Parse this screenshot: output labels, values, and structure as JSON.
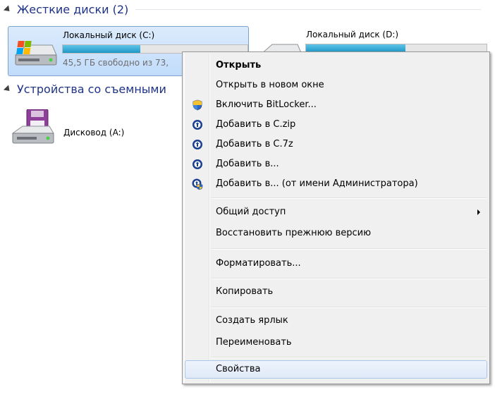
{
  "groups": {
    "hard_disks": {
      "title": "Жесткие диски (2)"
    },
    "removable": {
      "title": "Устройства со съемными"
    }
  },
  "drives": {
    "c": {
      "name": "Локальный диск (C:)",
      "free_text": "45,5 ГБ свободно из 73,",
      "used_fraction": 0.42
    },
    "d": {
      "name": "Локальный диск (D:)",
      "used_fraction": 0.55
    },
    "a": {
      "name": "Дисковод (A:)"
    }
  },
  "context_menu": {
    "items": [
      {
        "label": "Открыть",
        "icon": "",
        "bold": true
      },
      {
        "label": "Открыть в новом окне",
        "icon": ""
      },
      {
        "label": "Включить BitLocker...",
        "icon": "uac-shield-icon"
      },
      {
        "label": "Добавить в C.zip",
        "icon": "archiver-icon"
      },
      {
        "label": "Добавить в C.7z",
        "icon": "archiver-icon"
      },
      {
        "label": "Добавить в...",
        "icon": "archiver-icon"
      },
      {
        "label": "Добавить в... (от имени Администратора)",
        "icon": "archiver-admin-icon"
      },
      {
        "label": "Общий доступ",
        "icon": "",
        "submenu": true
      },
      {
        "label": "Восстановить прежнюю версию",
        "icon": ""
      },
      {
        "label": "Форматировать...",
        "icon": ""
      },
      {
        "label": "Копировать",
        "icon": ""
      },
      {
        "label": "Создать ярлык",
        "icon": ""
      },
      {
        "label": "Переименовать",
        "icon": ""
      },
      {
        "label": "Свойства",
        "icon": "",
        "highlighted": true
      }
    ]
  },
  "colors": {
    "group_header": "#1e3287",
    "selection": "#c1dcfc",
    "bar_fill": "#1f97c6",
    "menu_bg": "#f0f0f0"
  }
}
